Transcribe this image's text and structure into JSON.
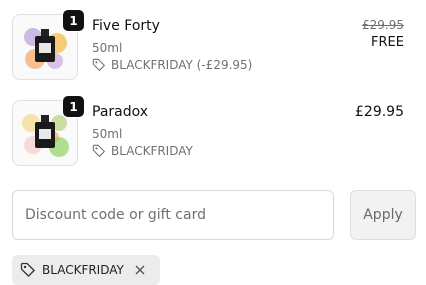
{
  "cart": {
    "items": [
      {
        "quantity": "1",
        "name": "Five Forty",
        "size": "50ml",
        "discount": "BLACKFRIDAY (-£29.95)",
        "original_price": "£29.95",
        "price": "FREE",
        "icons": [
          "product-image",
          "tag-icon"
        ]
      },
      {
        "quantity": "1",
        "name": "Paradox",
        "size": "50ml",
        "discount": "BLACKFRIDAY",
        "price": "£29.95",
        "icons": [
          "product-image",
          "tag-icon"
        ]
      }
    ]
  },
  "discount_form": {
    "placeholder": "Discount code or gift card",
    "apply_label": "Apply"
  },
  "applied_code": {
    "label": "BLACKFRIDAY",
    "icons": [
      "tag-icon",
      "close-icon"
    ]
  },
  "colors": {
    "text": "#111111",
    "muted": "#707070",
    "border": "#d9d9d9",
    "chip_bg": "#ececec",
    "badge_bg": "#111111"
  }
}
